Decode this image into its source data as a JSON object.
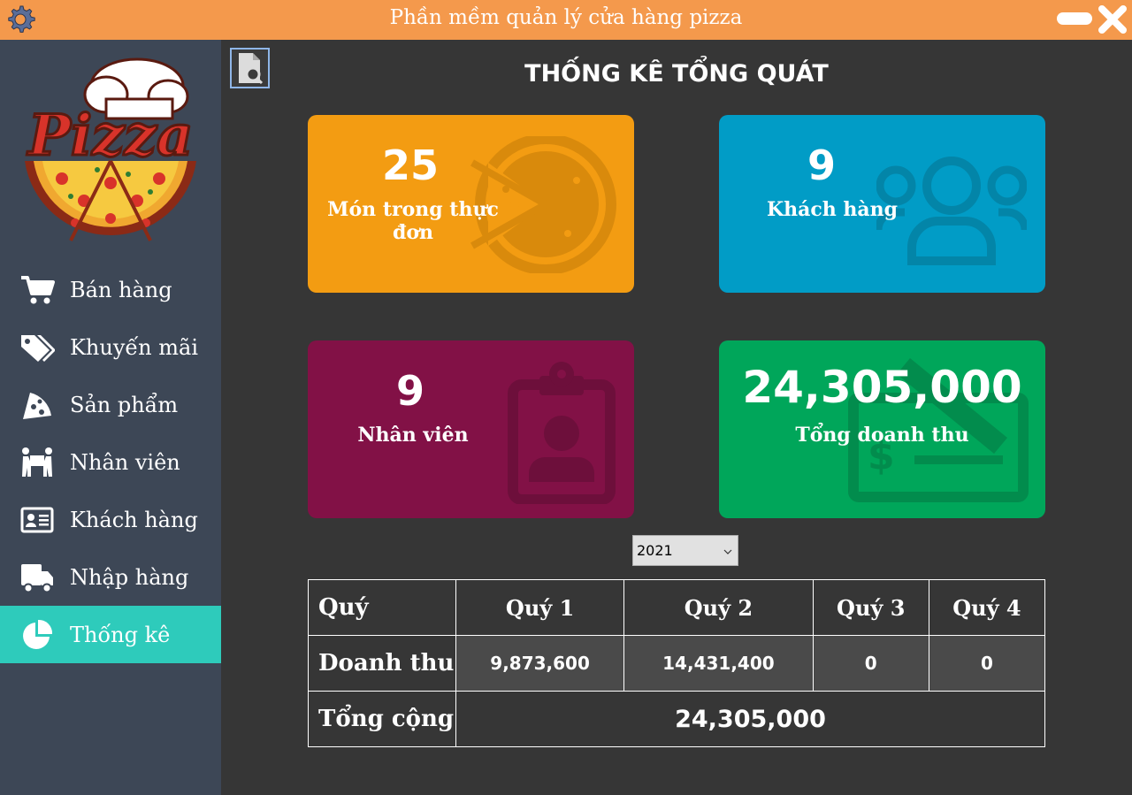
{
  "window": {
    "title": "Phần mềm quản lý cửa hàng pizza",
    "icons": [
      "settings-icon",
      "minimize-icon",
      "close-icon"
    ]
  },
  "logo": {
    "text": "Pizza"
  },
  "sidebar": {
    "items": [
      {
        "label": "Bán hàng",
        "icon": "cart-icon"
      },
      {
        "label": "Khuyến mãi",
        "icon": "tags-icon"
      },
      {
        "label": "Sản phẩm",
        "icon": "pizza-slice-icon"
      },
      {
        "label": "Nhân viên",
        "icon": "people-carry-icon"
      },
      {
        "label": "Khách hàng",
        "icon": "id-card-icon"
      },
      {
        "label": "Nhập hàng",
        "icon": "truck-icon"
      },
      {
        "label": "Thống kê",
        "icon": "pie-chart-icon",
        "active": true
      }
    ]
  },
  "main": {
    "title": "THỐNG KÊ TỔNG QUÁT",
    "cards": {
      "menu": {
        "value": "25",
        "caption": "Món trong thực đơn",
        "color": "#f39c12"
      },
      "customers": {
        "value": "9",
        "caption": "Khách hàng",
        "color": "#019cc6"
      },
      "staff": {
        "value": "9",
        "caption": "Nhân viên",
        "color": "#821146"
      },
      "revenue": {
        "value": "24,305,000",
        "caption": "Tổng doanh thu",
        "color": "#00a65a"
      }
    },
    "year_select": {
      "value": "2021"
    },
    "table": {
      "header": [
        "Quý",
        "Quý 1",
        "Quý 2",
        "Quý 3",
        "Quý 4"
      ],
      "revenue_label": "Doanh thu",
      "revenue": [
        "9,873,600",
        "14,431,400",
        "0",
        "0"
      ],
      "total_label": "Tổng cộng",
      "total": "24,305,000"
    }
  },
  "colors": {
    "titlebar": "#f4994c",
    "sidebar": "#3d4756",
    "active_nav": "#2ecbbb",
    "content_bg": "#363636"
  }
}
